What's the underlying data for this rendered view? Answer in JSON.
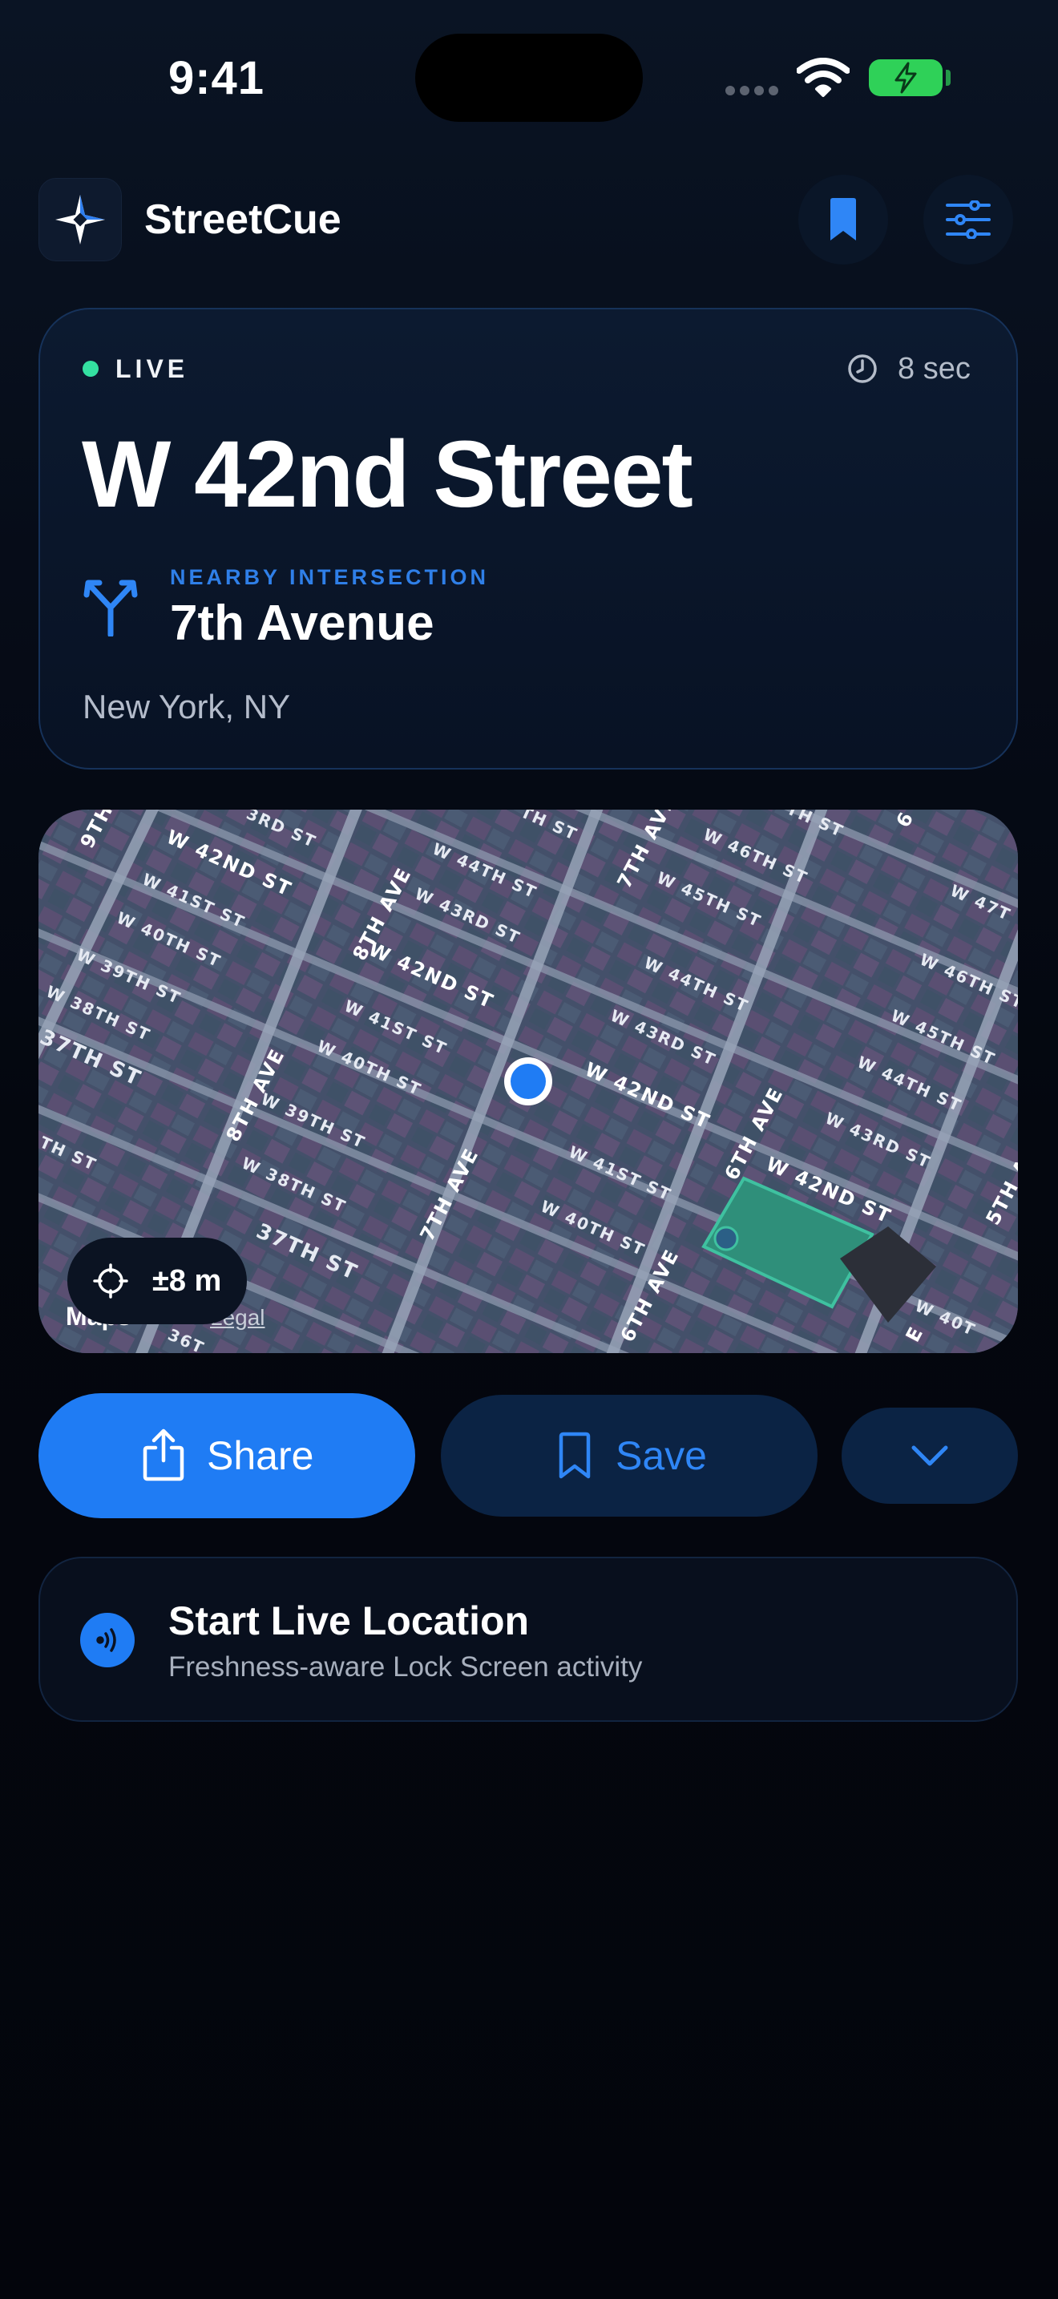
{
  "status_bar": {
    "time": "9:41"
  },
  "header": {
    "app_name": "StreetCue",
    "logo_icon": "compass-star-icon",
    "bookmarks_icon": "bookmark-icon",
    "settings_icon": "sliders-icon"
  },
  "location": {
    "live_label": "LIVE",
    "freshness": "8 sec",
    "street": "W 42nd Street",
    "intersection_label": "NEARBY INTERSECTION",
    "intersection": "7th Avenue",
    "city": "New York, NY"
  },
  "map": {
    "accuracy": "±8 m",
    "attribution": "Maps",
    "legal": "Legal",
    "street_labels": {
      "w42_a": "W 42ND ST",
      "w42_b": "W 42ND ST",
      "w42_c": "W 42ND ST",
      "w42_d": "W 42ND ST",
      "w41_a": "W 41ST ST",
      "w41_b": "W 41ST ST",
      "w41_c": "W 41ST ST",
      "w40_a": "W 40TH ST",
      "w40_b": "W 40TH ST",
      "w40_c": "W 40TH ST",
      "w39_a": "W 39TH ST",
      "w39_b": "W 39TH ST",
      "w38_a": "W 38TH ST",
      "w38_b": "W 38TH ST",
      "w37_a": "37TH ST",
      "w37_b": "37TH ST",
      "w43_a": "3RD ST",
      "w43_b": "W 43RD ST",
      "w43_c": "W 43RD ST",
      "w43_d": "W 43RD ST",
      "w44_a": "W 44TH ST",
      "w44_b": "W 44TH ST",
      "w44_c": "W 44TH ST",
      "w45_a": "W 45TH ST",
      "w45_b": "W 45TH ST",
      "w46_a": "W 46TH ST",
      "w46_b": "W 46TH ST",
      "w47_a": "W 47T",
      "w36_a": "36T",
      "w40_d": "W 40T",
      "top_a": "TH ST",
      "top_b": "TH ST",
      "top_c": "TH ST",
      "ave_8a": "8TH AVE",
      "ave_8b": "8TH AVE",
      "ave_7a": "7TH AVE",
      "ave_7b": "7TH AVE",
      "ave_6a": "6TH AVE",
      "ave_6b": "6TH AVE",
      "ave_5": "5TH AVE",
      "ave_9": "9TH",
      "ave_6c": "6",
      "ave_e": "E"
    }
  },
  "actions": {
    "share": "Share",
    "share_icon": "share-icon",
    "save": "Save",
    "save_icon": "bookmark-icon",
    "more_icon": "chevron-down-icon"
  },
  "live_activity": {
    "title": "Start Live Location",
    "subtitle": "Freshness-aware Lock Screen activity",
    "icon": "broadcast-icon"
  },
  "colors": {
    "accent": "#1f7cf4",
    "live": "#34e0a1",
    "battery": "#2fd158"
  }
}
